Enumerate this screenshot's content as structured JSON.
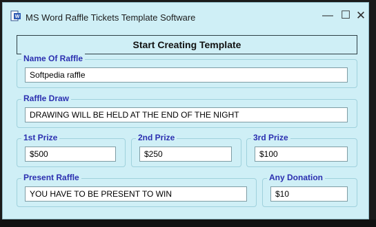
{
  "window": {
    "title": "MS Word Raffle Tickets Template Software",
    "minimize_glyph": "—",
    "maximize_glyph": "☐",
    "close_glyph": "✕"
  },
  "start_button": {
    "label": "Start Creating Template"
  },
  "groups": {
    "name_of_raffle": {
      "label": "Name Of Raffle",
      "value": "Softpedia raffle"
    },
    "raffle_draw": {
      "label": "Raffle Draw",
      "value": "DRAWING WILL BE HELD AT THE END OF THE NIGHT"
    },
    "first_prize": {
      "label": "1st Prize",
      "value": "$500"
    },
    "second_prize": {
      "label": "2nd Prize",
      "value": "$250"
    },
    "third_prize": {
      "label": "3rd Prize",
      "value": "$100"
    },
    "present_raffle": {
      "label": "Present Raffle",
      "value": "YOU HAVE TO BE PRESENT TO WIN"
    },
    "any_donation": {
      "label": "Any Donation",
      "value": "$10"
    }
  },
  "colors": {
    "window_bg": "#cfeff6",
    "label_blue": "#2b2fb0",
    "group_border": "#9fd1dc"
  },
  "icons": {
    "app": "word-document-icon"
  }
}
